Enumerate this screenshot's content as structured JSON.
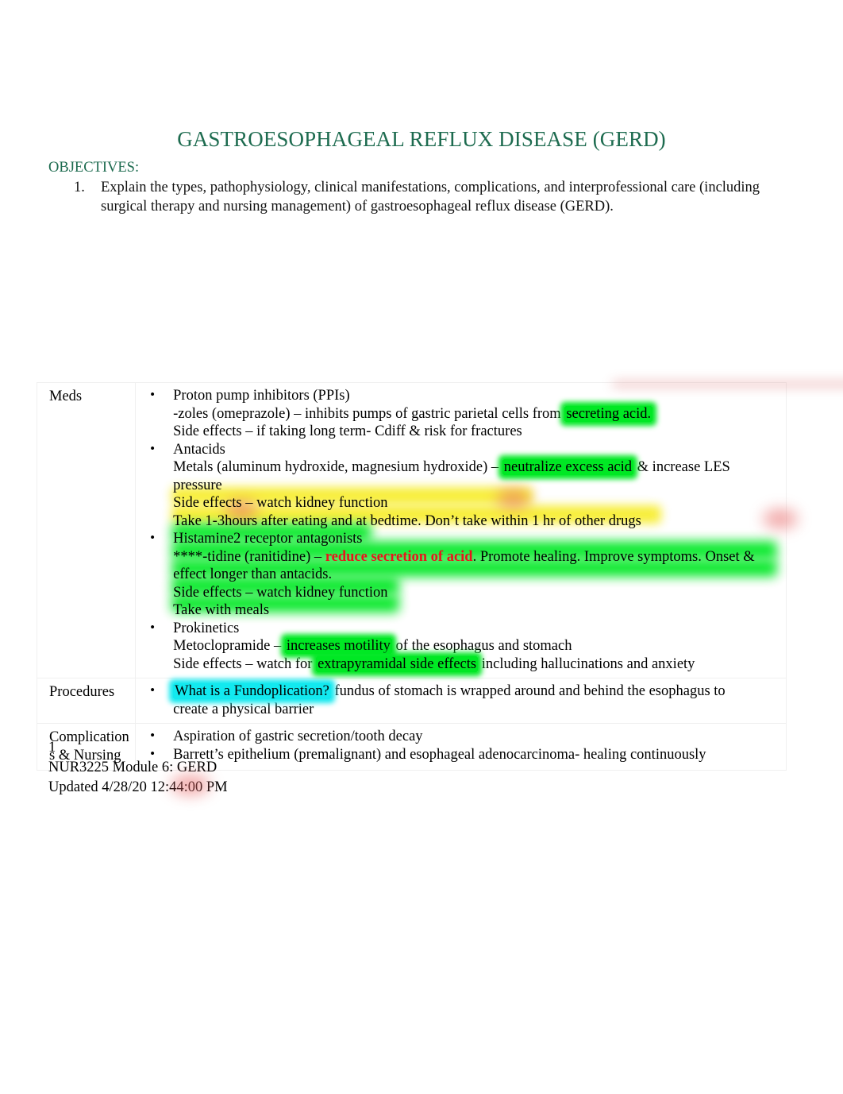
{
  "document": {
    "title": "GASTROESOPHAGEAL REFLUX DISEASE (GERD)",
    "title_color": "#1d6b4f",
    "objectives_heading": "OBJECTIVES:",
    "objectives": [
      {
        "number": "1.",
        "text": "Explain the types, pathophysiology, clinical manifestations, complications, and interprofessional care (including surgical therapy and nursing management) of gastroesophageal reflux disease (GERD)."
      }
    ]
  },
  "table": {
    "rows": [
      {
        "label": "Meds",
        "bullets": [
          {
            "lines": [
              "Proton pump inhibitors (PPIs)",
              "-zoles (omeprazole) – inhibits pumps of gastric parietal cells from secreting acid.",
              "Side effects – if taking long term- Cdiff & risk for fractures"
            ],
            "l2_pre": "-zoles (omeprazole) – inhibits pumps of gastric parietal cells from ",
            "l2_hl": "secreting acid."
          },
          {
            "lines": [
              "Antacids",
              "Metals (aluminum hydroxide, magnesium hydroxide) – neutralize excess acid & increase LES pressure",
              "Side effects – watch kidney function",
              "Take 1-3hours after eating and at bedtime. Don’t take within 1 hr of other drugs"
            ],
            "l2_pre": "Metals (aluminum hydroxide, magnesium hydroxide) – ",
            "l2_hl": "neutralize excess acid",
            "l2_post": " & increase LES pressure",
            "l3_pre": "Side effects – ",
            "l3_hl": "watch kidney function",
            "l4_hl": "Take 1-3hours after eating and at bedtime. Don’t take within 1 hr of other drugs"
          },
          {
            "lines": [
              "Histamine2 receptor antagonists",
              "****-tidine (ranitidine) – reduce secretion of acid. Promote healing. Improve symptoms. Onset & effect longer than antacids.",
              "Side effects – watch kidney function",
              "Take with meals"
            ],
            "l1": "Histamine2 receptor antagonists",
            "l2_pre": "****-tidine (ranitidine) – ",
            "l2_red": "reduce secretion of acid",
            "l2_post": ". Promote healing. Improve symptoms. Onset &",
            "l2b": "effect longer than antacids.",
            "l3": "Side effects – watch kidney function",
            "l4": "Take with meals"
          },
          {
            "lines": [
              "Prokinetics",
              "Metoclopramide – increases motility of the esophagus and stomach",
              "Side effects – watch for extrapyramidal side effects including hallucinations and anxiety"
            ],
            "l2_pre": "Metoclopramide – ",
            "l2_hl": "increases motility",
            "l2_post": " of the esophagus and stomach",
            "l3_pre": "Side effects – watch for ",
            "l3_hl": "extrapyramidal side effects",
            "l3_post": " including hallucinations and anxiety"
          }
        ]
      },
      {
        "label": "Procedures",
        "bullets": [
          {
            "l1_hl": "What is a Fundoplication?",
            "l1_post": " fundus of stomach is wrapped around and behind the esophagus to",
            "l2": "create a physical barrier"
          }
        ]
      },
      {
        "label": "Complications & Nursing",
        "label_line1": "Complication",
        "label_line2": "s & Nursing",
        "bullets": [
          {
            "l1": "Aspiration of gastric secretion/tooth decay"
          },
          {
            "l1": "Barrett’s epithelium (premalignant) and esophageal adenocarcinoma- healing continuously"
          }
        ]
      }
    ]
  },
  "footer": {
    "page_number": "1",
    "course": "NUR3225 Module 6: GERD",
    "updated": "Updated 4/28/20 12:44:00 PM"
  },
  "highlight_colors": {
    "green": "#00e824",
    "yellow": "#f7ed2f",
    "cyan": "#12e9ef",
    "red_text": "#e8151b",
    "heading_green": "#1d6b4f"
  }
}
